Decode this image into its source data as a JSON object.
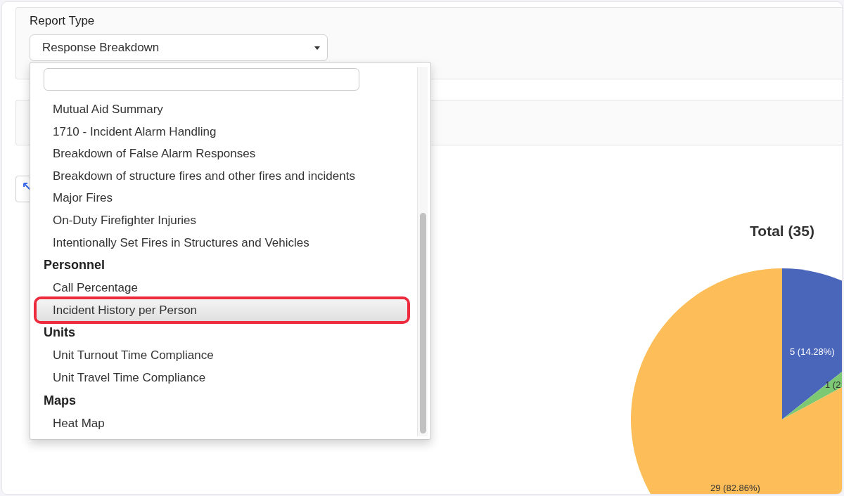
{
  "report_type": {
    "label": "Report Type",
    "value": "Response Breakdown"
  },
  "dropdown": {
    "groups": [
      {
        "items": [
          {
            "label": "Mutual Aid Summary",
            "selected": false
          },
          {
            "label": "1710 - Incident Alarm Handling",
            "selected": false
          },
          {
            "label": "Breakdown of False Alarm Responses",
            "selected": false
          },
          {
            "label": "Breakdown of structure fires and other fires and incidents",
            "selected": false
          },
          {
            "label": "Major Fires",
            "selected": false
          },
          {
            "label": "On-Duty Firefighter Injuries",
            "selected": false
          },
          {
            "label": "Intentionally Set Fires in Structures and Vehicles",
            "selected": false
          }
        ]
      },
      {
        "heading": "Personnel",
        "items": [
          {
            "label": "Call Percentage",
            "selected": false
          },
          {
            "label": "Incident History per Person",
            "selected": true
          }
        ]
      },
      {
        "heading": "Units",
        "items": [
          {
            "label": "Unit Turnout Time Compliance",
            "selected": false
          },
          {
            "label": "Unit Travel Time Compliance",
            "selected": false
          }
        ]
      },
      {
        "heading": "Maps",
        "items": [
          {
            "label": "Heat Map",
            "selected": false
          }
        ]
      }
    ]
  },
  "chart": {
    "chart_data": {
      "type": "pie",
      "title": "Total (35)",
      "series": [
        {
          "values": [
            14.28,
            2.86,
            82.86
          ]
        }
      ],
      "colors": [
        "#4a66bb",
        "#7dc873",
        "#fdbd58"
      ],
      "value_labels": [
        "5 (14.28%)",
        "1 (2",
        "29 (82.86%)"
      ]
    }
  }
}
